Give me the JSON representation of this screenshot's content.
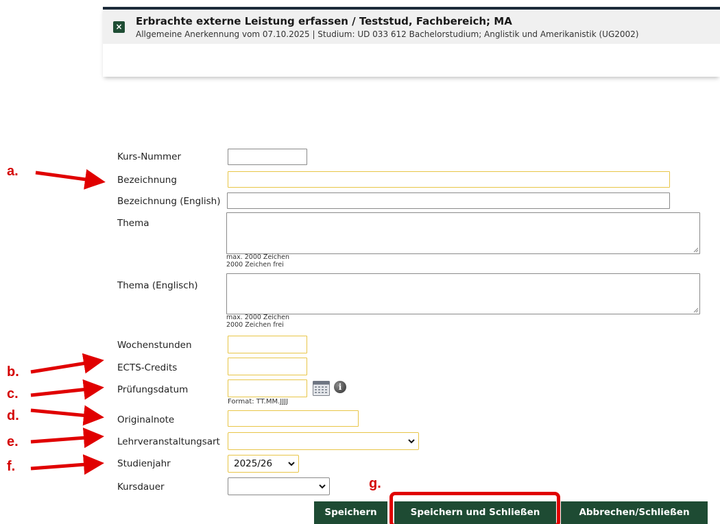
{
  "dialog": {
    "title": "Erbrachte externe Leistung erfassen / Teststud, Fachbereich; MA",
    "subtitle": "Allgemeine Anerkennung vom 07.10.2025 | Studium: UD 033 612 Bachelorstudium; Anglistik und Amerikanistik (UG2002)",
    "close_symbol": "×"
  },
  "form": {
    "kurs_nummer": {
      "label": "Kurs-Nummer",
      "value": ""
    },
    "bezeichnung": {
      "label": "Bezeichnung",
      "value": ""
    },
    "bezeichnung_en": {
      "label": "Bezeichnung (English)",
      "value": ""
    },
    "thema": {
      "label": "Thema",
      "value": "",
      "hint_max": "max. 2000 Zeichen",
      "hint_free": "2000 Zeichen frei"
    },
    "thema_en": {
      "label": "Thema (Englisch)",
      "value": "",
      "hint_max": "max. 2000 Zeichen",
      "hint_free": "2000 Zeichen frei"
    },
    "wochenstunden": {
      "label": "Wochenstunden",
      "value": ""
    },
    "ects": {
      "label": "ECTS-Credits",
      "value": ""
    },
    "pruefungsdatum": {
      "label": "Prüfungsdatum",
      "value": "",
      "format_hint": "Format: TT.MM.JJJJ",
      "info_symbol": "i"
    },
    "originalnote": {
      "label": "Originalnote",
      "value": ""
    },
    "lv_art": {
      "label": "Lehrveranstaltungsart",
      "selected": ""
    },
    "studienjahr": {
      "label": "Studienjahr",
      "selected": "2025/26"
    },
    "kursdauer": {
      "label": "Kursdauer",
      "selected": ""
    }
  },
  "buttons": {
    "save": "Speichern",
    "save_close": "Speichern und Schließen",
    "cancel_close": "Abbrechen/Schließen"
  },
  "annotations": {
    "a": "a.",
    "b": "b.",
    "c": "c.",
    "d": "d.",
    "e": "e.",
    "f": "f.",
    "g": "g.",
    "color": "#d40000"
  },
  "colors": {
    "button_green": "#1e4b33",
    "required_border": "#e8c547",
    "header_border": "#1c2b3a"
  }
}
